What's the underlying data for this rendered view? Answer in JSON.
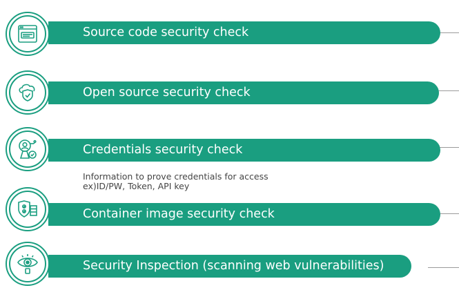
{
  "colors": {
    "accent": "#1a9e80",
    "line": "#9a9a9a"
  },
  "items": [
    {
      "label": "Source code security check",
      "icon": "code-window-icon"
    },
    {
      "label": "Open source security check",
      "icon": "cloud-shield-icon"
    },
    {
      "label": "Credentials security check",
      "icon": "credential-user-icon",
      "description": "Information to prove credentials for access\nex)ID/PW, Token, API key"
    },
    {
      "label": "Container image security check",
      "icon": "container-shield-icon"
    },
    {
      "label": "Security Inspection (scanning web vulnerabilities)",
      "icon": "eye-scan-icon"
    }
  ]
}
